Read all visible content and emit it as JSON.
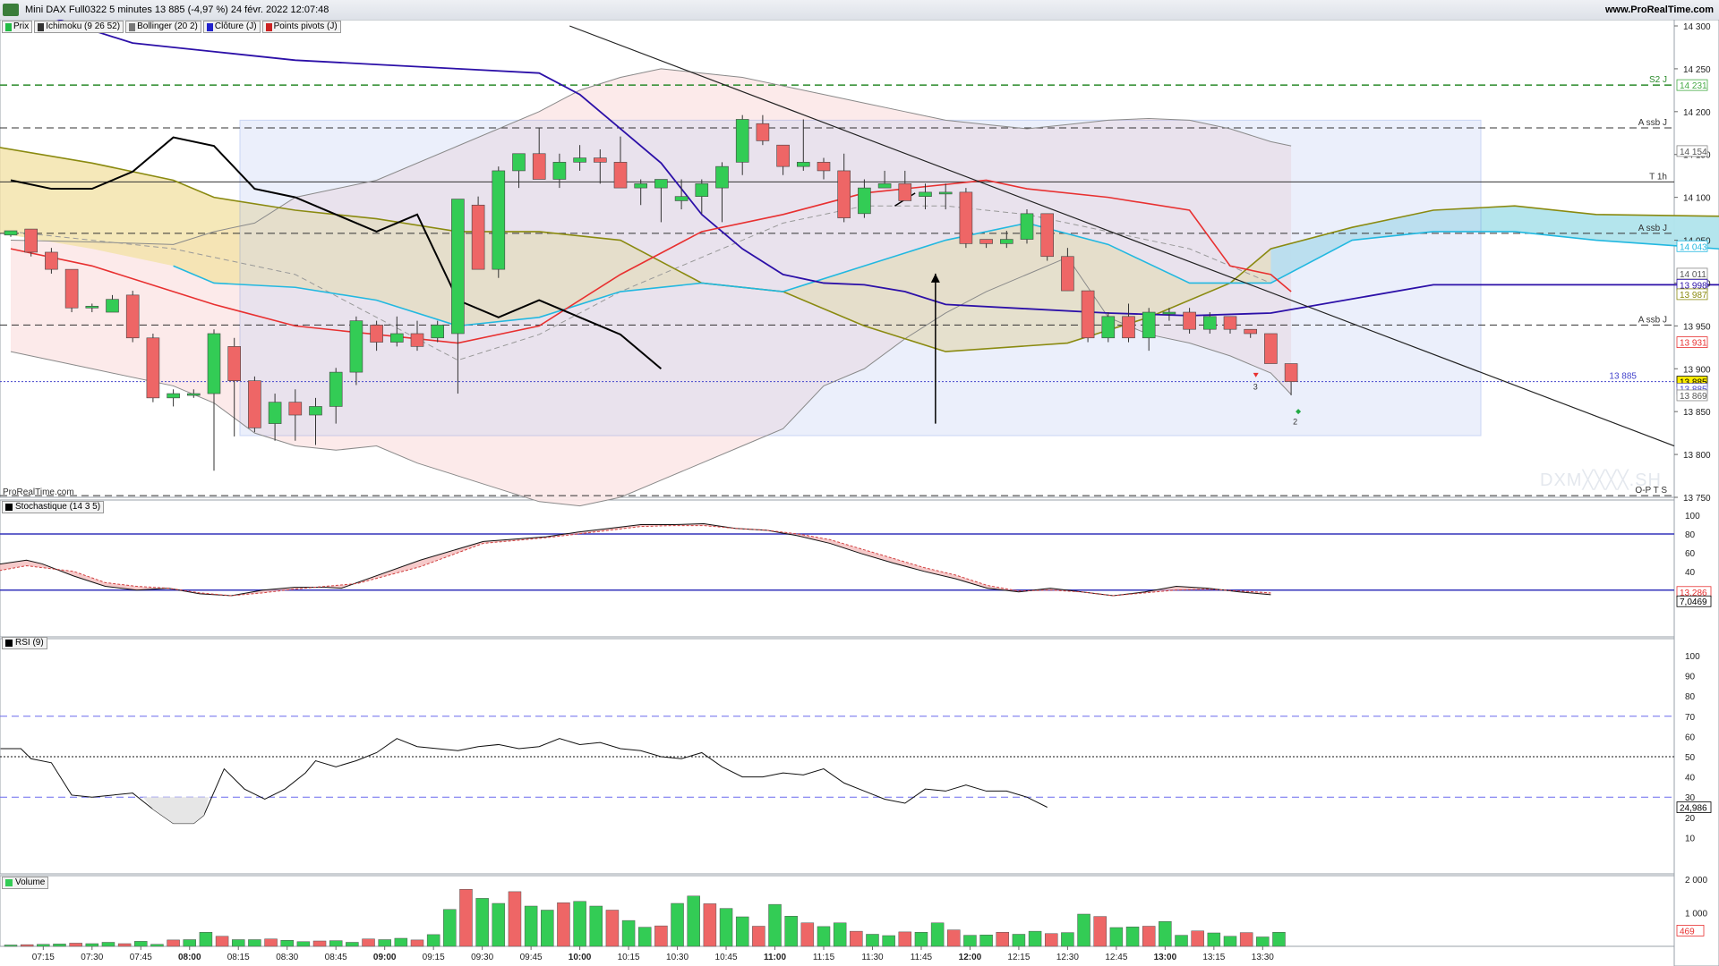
{
  "window": {
    "title": "Mini DAX Full0322 5 minutes 13 885 (-4,97 %) 24 févr. 2022 12:07:48",
    "url": "www.ProRealTime.com",
    "brand": "ProRealTime.com",
    "watermark": "DXM╳╳╳╳.SH"
  },
  "legend": [
    {
      "label": "Prix",
      "color": "#22bb44"
    },
    {
      "label": "Ichimoku (9 26 52)",
      "color": "#333333"
    },
    {
      "label": "Bollinger (20 2)",
      "color": "#777777"
    },
    {
      "label": "Clôture (J)",
      "color": "#2222cc"
    },
    {
      "label": "Points pivots (J)",
      "color": "#cc2222"
    }
  ],
  "panels": {
    "stoch": {
      "label": "Stochastique (14 3 5)"
    },
    "rsi": {
      "label": "RSI (9)"
    },
    "volume": {
      "label": "Volume"
    }
  },
  "colors": {
    "up": "#33cc55",
    "down": "#ee6666",
    "tenkan": "#e83030",
    "kijun": "#2c10a8",
    "chikou": "#000000",
    "ssa": "#22b8e0",
    "ssb": "#8a8a10",
    "bollinger": "#8a8a8a"
  },
  "chart_data": [
    {
      "type": "candlestick",
      "title": "Mini DAX Full0322 5 minutes",
      "time_labels": [
        "07:15",
        "07:30",
        "07:45",
        "08:00",
        "08:15",
        "08:30",
        "08:45",
        "09:00",
        "09:15",
        "09:30",
        "09:45",
        "10:00",
        "10:15",
        "10:30",
        "10:45",
        "11:00",
        "11:15",
        "11:30",
        "11:45",
        "12:00",
        "12:15",
        "12:30",
        "12:45",
        "13:00",
        "13:15",
        "13:30"
      ],
      "y_ticks": [
        14300,
        14250,
        14200,
        14150,
        14100,
        14050,
        14000,
        13950,
        13900,
        13850,
        13800,
        13750
      ],
      "price_tags": [
        {
          "value": "14 231",
          "color": "#44aa44",
          "text": "#44aa44"
        },
        {
          "value": "14 154",
          "color": "#888888",
          "text": "#555555"
        },
        {
          "value": "14 043",
          "color": "#22b8e0",
          "text": "#22b8e0"
        },
        {
          "value": "14 011",
          "color": "#888888",
          "text": "#555555"
        },
        {
          "value": "13 998",
          "color": "#2c10a8",
          "text": "#2c10a8"
        },
        {
          "value": "13 987",
          "color": "#8a8a10",
          "text": "#8a8a10"
        },
        {
          "value": "13 931",
          "color": "#e83030",
          "text": "#e83030"
        },
        {
          "value": "13 885",
          "color": "#000000",
          "text": "#000000",
          "bg": "#ffee00"
        },
        {
          "value": "13 885",
          "color": "#6666cc",
          "text": "#4444cc"
        },
        {
          "value": "13 869",
          "color": "#888888",
          "text": "#555555"
        }
      ],
      "levels": [
        {
          "label": "S2 J",
          "value": 14231,
          "color": "#2a8a2a"
        },
        {
          "label": "A ssb J",
          "value": 14181,
          "color": "#333333"
        },
        {
          "label": "T 1h",
          "value": 14118,
          "color": "#333333"
        },
        {
          "label": "A ssb J",
          "value": 14058,
          "color": "#333333"
        },
        {
          "label": "A ssb J",
          "value": 13951,
          "color": "#333333"
        },
        {
          "label": "O-P T S",
          "value": 13752,
          "color": "#333333"
        },
        {
          "label": "13 885",
          "value": 13885,
          "color": "#4444cc"
        }
      ],
      "candles": [
        [
          14056,
          14061,
          14054,
          14061
        ],
        [
          14063,
          14063,
          14031,
          14036
        ],
        [
          14036,
          14041,
          14011,
          14016
        ],
        [
          14016,
          14016,
          13966,
          13971
        ],
        [
          13973,
          13976,
          13966,
          13973
        ],
        [
          13966,
          13986,
          13966,
          13981
        ],
        [
          13986,
          13991,
          13931,
          13936
        ],
        [
          13936,
          13941,
          13861,
          13866
        ],
        [
          13866,
          13876,
          13856,
          13871
        ],
        [
          13871,
          13876,
          13866,
          13871
        ],
        [
          13871,
          13946,
          13781,
          13941
        ],
        [
          13926,
          13936,
          13821,
          13886
        ],
        [
          13886,
          13891,
          13826,
          13831
        ],
        [
          13836,
          13871,
          13816,
          13861
        ],
        [
          13861,
          13876,
          13816,
          13846
        ],
        [
          13846,
          13866,
          13811,
          13856
        ],
        [
          13856,
          13901,
          13836,
          13896
        ],
        [
          13896,
          13961,
          13881,
          13956
        ],
        [
          13951,
          13956,
          13921,
          13931
        ],
        [
          13931,
          13961,
          13926,
          13941
        ],
        [
          13941,
          13956,
          13921,
          13926
        ],
        [
          13936,
          13956,
          13931,
          13951
        ],
        [
          13941,
          13961,
          13871,
          14098
        ],
        [
          14091,
          14101,
          14021,
          14016
        ],
        [
          14016,
          14136,
          14006,
          14131
        ],
        [
          14131,
          14151,
          14111,
          14151
        ],
        [
          14151,
          14181,
          14121,
          14121
        ],
        [
          14121,
          14151,
          14111,
          14141
        ],
        [
          14141,
          14161,
          14131,
          14146
        ],
        [
          14146,
          14156,
          14116,
          14141
        ],
        [
          14141,
          14171,
          14121,
          14111
        ],
        [
          14111,
          14121,
          14091,
          14116
        ],
        [
          14111,
          14116,
          14071,
          14121
        ],
        [
          14096,
          14121,
          14086,
          14101
        ],
        [
          14101,
          14121,
          14081,
          14116
        ],
        [
          14111,
          14141,
          14071,
          14136
        ],
        [
          14141,
          14196,
          14126,
          14191
        ],
        [
          14186,
          14196,
          14161,
          14166
        ],
        [
          14161,
          14161,
          14126,
          14136
        ],
        [
          14136,
          14191,
          14131,
          14141
        ],
        [
          14141,
          14146,
          14121,
          14131
        ],
        [
          14131,
          14151,
          14071,
          14076
        ],
        [
          14081,
          14121,
          14076,
          14111
        ],
        [
          14111,
          14131,
          14111,
          14116
        ],
        [
          14116,
          14131,
          14096,
          14096
        ],
        [
          14101,
          14116,
          14086,
          14106
        ],
        [
          14106,
          14116,
          14086,
          14106
        ],
        [
          14106,
          14111,
          14041,
          14046
        ],
        [
          14051,
          14051,
          14041,
          14046
        ],
        [
          14046,
          14061,
          14041,
          14051
        ],
        [
          14051,
          14086,
          14046,
          14081
        ],
        [
          14081,
          14081,
          14026,
          14031
        ],
        [
          14031,
          14041,
          13991,
          13991
        ],
        [
          13991,
          13991,
          13931,
          13936
        ],
        [
          13936,
          13966,
          13931,
          13961
        ],
        [
          13961,
          13976,
          13931,
          13936
        ],
        [
          13936,
          13971,
          13921,
          13966
        ],
        [
          13966,
          13971,
          13956,
          13966
        ],
        [
          13966,
          13971,
          13941,
          13946
        ],
        [
          13946,
          13966,
          13941,
          13961
        ],
        [
          13961,
          13961,
          13941,
          13946
        ],
        [
          13946,
          13946,
          13936,
          13941
        ],
        [
          13941,
          13941,
          13906,
          13906
        ],
        [
          13906,
          13906,
          13869,
          13885
        ]
      ],
      "x": [
        "07:15",
        "07:30",
        "07:45",
        "08:00",
        "08:15",
        "08:30",
        "08:45",
        "09:00",
        "09:15",
        "09:30",
        "09:45",
        "10:00",
        "10:15",
        "10:30",
        "10:45",
        "11:00",
        "11:15",
        "11:30",
        "11:45",
        "12:00"
      ]
    },
    {
      "type": "line",
      "title": "Stochastique (14 3 5)",
      "y_ticks": [
        100,
        80,
        60,
        40
      ],
      "levels": [
        80,
        20
      ],
      "tags": [
        {
          "value": "13,286",
          "color": "#e83030"
        },
        {
          "value": "7,0469",
          "color": "#000000"
        }
      ]
    },
    {
      "type": "line",
      "title": "RSI (9)",
      "y_ticks": [
        100,
        90,
        80,
        70,
        60,
        50,
        40,
        30,
        20,
        10
      ],
      "levels": [
        70,
        50,
        30
      ],
      "tags": [
        {
          "value": "24,986",
          "color": "#000000"
        }
      ]
    },
    {
      "type": "bar",
      "title": "Volume",
      "y_ticks": [
        "2 000",
        "1 000"
      ],
      "tags": [
        {
          "value": "469",
          "color": "#e83030"
        }
      ],
      "values": [
        40,
        50,
        60,
        70,
        95,
        80,
        120,
        80,
        150,
        60,
        190,
        200,
        420,
        300,
        200,
        200,
        220,
        180,
        140,
        160,
        170,
        120,
        220,
        200,
        240,
        190,
        350,
        1100,
        1700,
        1430,
        1280,
        1630,
        1200,
        1080,
        1300,
        1340,
        1200,
        1080,
        770,
        570,
        610,
        1280,
        1500,
        1270,
        1130,
        880,
        600,
        1250,
        900,
        700,
        590,
        700,
        450,
        360,
        320,
        430,
        420,
        700,
        490,
        330,
        340,
        420,
        360,
        450,
        380,
        410,
        960,
        890,
        560,
        580,
        600,
        740,
        330,
        460,
        400,
        300,
        410,
        280,
        420
      ]
    }
  ]
}
